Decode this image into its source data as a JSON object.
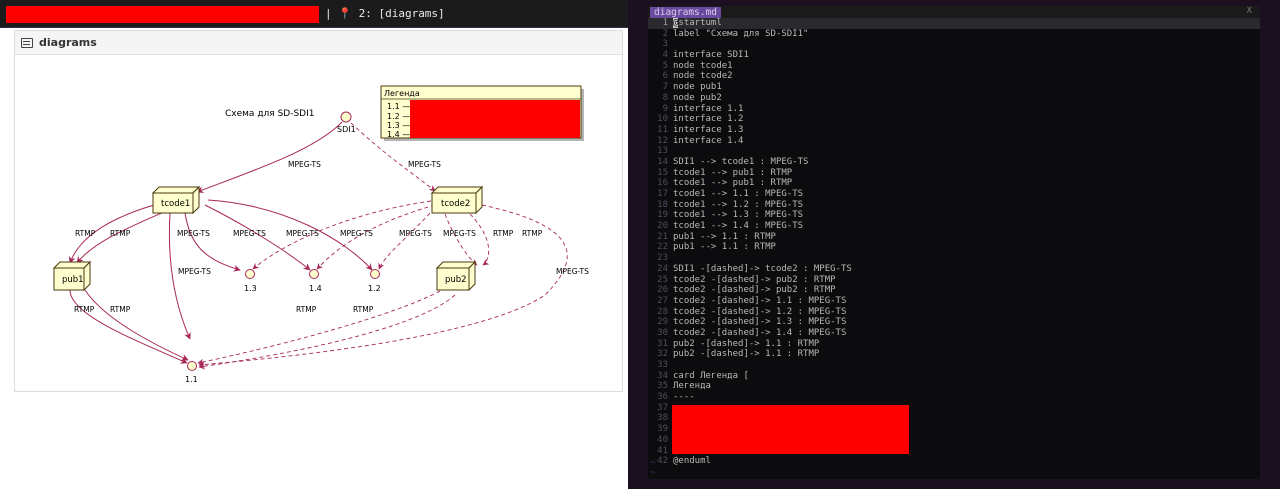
{
  "left_window": {
    "tab_number": "2:",
    "tab_title": "[diagrams]",
    "pin_icon": "pin-icon"
  },
  "preview": {
    "title": "diagrams",
    "icon": "document-icon"
  },
  "diagram": {
    "caption": "Схема для SD-SDI1",
    "nodes": {
      "sdi1": "SDI1",
      "tcode1": "tcode1",
      "tcode2": "tcode2",
      "pub1": "pub1",
      "pub2": "pub2",
      "i11": "1.1",
      "i12": "1.2",
      "i13": "1.3",
      "i14": "1.4"
    },
    "legend": {
      "title": "Легенда",
      "items": [
        "1.1 —",
        "1.2 —",
        "1.3 —",
        "1.4 —"
      ]
    },
    "edge_labels": {
      "mpeg": "MPEG-TS",
      "rtmp": "RTMP"
    }
  },
  "editor": {
    "filename": "diagrams.md",
    "close": "X",
    "lines": [
      "@startuml",
      "label \"Схема для SD-SDI1\"",
      "",
      "interface SDI1",
      "node tcode1",
      "node tcode2",
      "node pub1",
      "node pub2",
      "interface 1.1",
      "interface 1.2",
      "interface 1.3",
      "interface 1.4",
      "",
      "SDI1 --> tcode1 : MPEG-TS",
      "tcode1 --> pub1 : RTMP",
      "tcode1 --> pub1 : RTMP",
      "tcode1 --> 1.1 : MPEG-TS",
      "tcode1 --> 1.2 : MPEG-TS",
      "tcode1 --> 1.3 : MPEG-TS",
      "tcode1 --> 1.4 : MPEG-TS",
      "pub1 --> 1.1 : RTMP",
      "pub1 --> 1.1 : RTMP",
      "",
      "SDI1 -[dashed]-> tcode2 : MPEG-TS",
      "tcode2 -[dashed]-> pub2 : RTMP",
      "tcode2 -[dashed]-> pub2 : RTMP",
      "tcode2 -[dashed]-> 1.1 : MPEG-TS",
      "tcode2 -[dashed]-> 1.2 : MPEG-TS",
      "tcode2 -[dashed]-> 1.3 : MPEG-TS",
      "tcode2 -[dashed]-> 1.4 : MPEG-TS",
      "pub2 -[dashed]-> 1.1 : RTMP",
      "pub2 -[dashed]-> 1.1 : RTMP",
      "",
      "card Легенда [",
      "Легенда",
      "----",
      "",
      "",
      "",
      "",
      "]",
      "@enduml"
    ]
  },
  "colors": {
    "edge": "#a8285a",
    "node_fill": "#fefece",
    "node_stroke": "#4a3a10",
    "tab_accent": "#6a4aa0"
  }
}
